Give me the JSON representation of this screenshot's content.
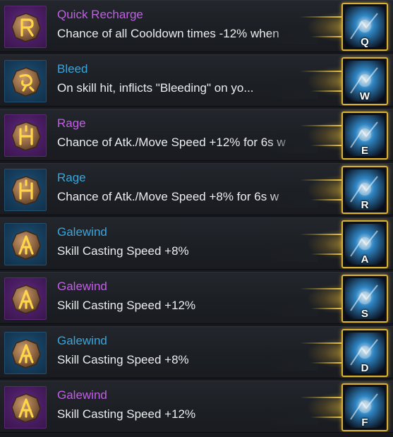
{
  "colors": {
    "legendary": "#c25fe6",
    "epic": "#3aa6dc",
    "slot_border": "#d9b134"
  },
  "runes": [
    {
      "name": "Quick Recharge",
      "desc": "Chance of all Cooldown times -12% when",
      "grade": "legendary",
      "glyph": "R",
      "skill_icon": "ice-pillar-icon",
      "key": "Q",
      "skill_color": "#2f86c4"
    },
    {
      "name": "Bleed",
      "desc": "On skill hit, inflicts \"Bleeding\" on yo...",
      "grade": "epic",
      "glyph": "swirl",
      "skill_icon": "lightning-burst-icon",
      "key": "W",
      "skill_color": "#3c9ee0"
    },
    {
      "name": "Rage",
      "desc": "Chance of Atk./Move Speed +12% for 6s w",
      "grade": "legendary",
      "glyph": "H",
      "skill_icon": "frost-cage-icon",
      "key": "E",
      "skill_color": "#2a78b8"
    },
    {
      "name": "Rage",
      "desc": "Chance of Atk./Move Speed +8% for 6s w",
      "grade": "epic",
      "glyph": "H",
      "skill_icon": "frost-crab-icon",
      "key": "R",
      "skill_color": "#1f5f9c"
    },
    {
      "name": "Galewind",
      "desc": "Skill Casting Speed +8%",
      "grade": "epic",
      "glyph": "A",
      "skill_icon": "shadow-slash-icon",
      "key": "A",
      "skill_color": "#5b3bb0"
    },
    {
      "name": "Galewind",
      "desc": "Skill Casting Speed +12%",
      "grade": "legendary",
      "glyph": "A",
      "skill_icon": "purple-vortex-icon",
      "key": "S",
      "skill_color": "#7a3fd0"
    },
    {
      "name": "Galewind",
      "desc": "Skill Casting Speed +8%",
      "grade": "epic",
      "glyph": "A",
      "skill_icon": "dark-ring-icon",
      "key": "D",
      "skill_color": "#6a47c8"
    },
    {
      "name": "Galewind",
      "desc": "Skill Casting Speed +12%",
      "grade": "legendary",
      "glyph": "A",
      "skill_icon": "arcane-burst-icon",
      "key": "F",
      "skill_color": "#8a4ae0"
    }
  ]
}
